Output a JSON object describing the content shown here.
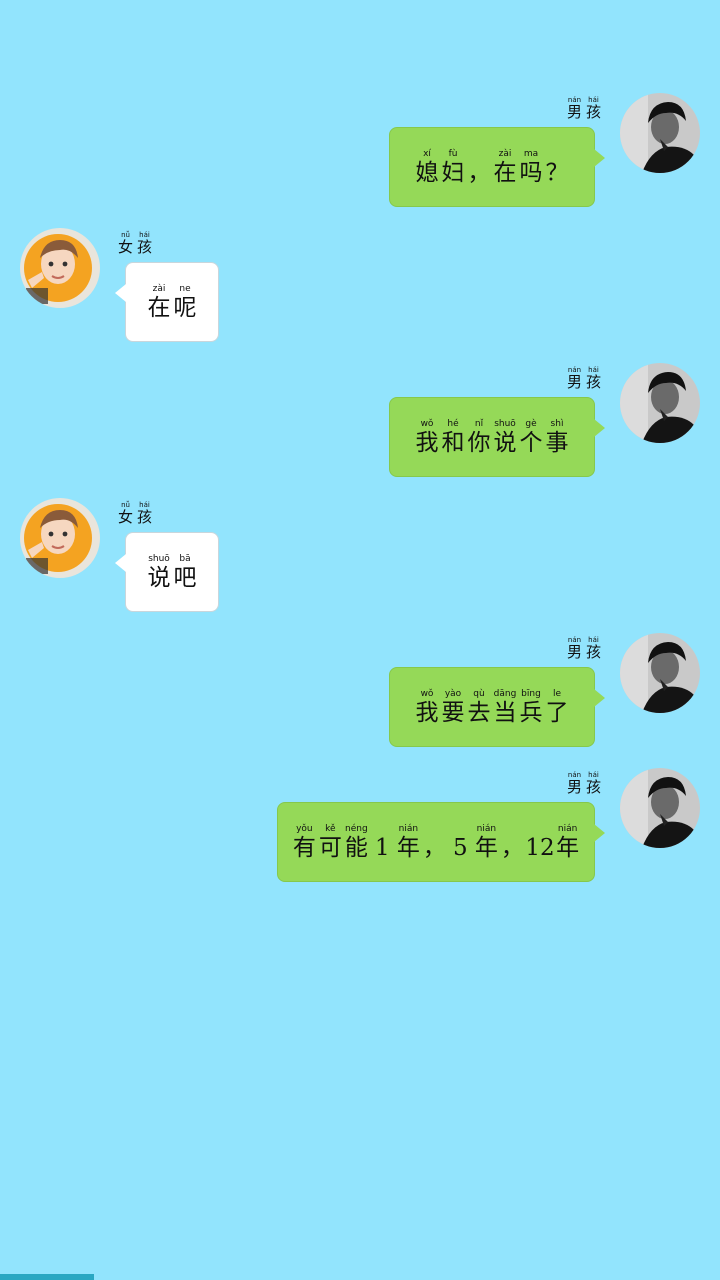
{
  "boy_name": [
    {
      "py": "nán",
      "hz": "男"
    },
    {
      "py": "hái",
      "hz": "孩"
    }
  ],
  "girl_name": [
    {
      "py": "nǚ",
      "hz": "女"
    },
    {
      "py": "hái",
      "hz": "孩"
    }
  ],
  "messages": [
    {
      "sender": "boy",
      "tokens": [
        {
          "py": "xí",
          "hz": "媳"
        },
        {
          "py": "fù",
          "hz": "妇"
        },
        {
          "py": "",
          "hz": "，"
        },
        {
          "py": "zài",
          "hz": "在"
        },
        {
          "py": "ma",
          "hz": "吗"
        },
        {
          "py": "",
          "hz": "？"
        }
      ]
    },
    {
      "sender": "girl",
      "tokens": [
        {
          "py": "zài",
          "hz": "在"
        },
        {
          "py": "ne",
          "hz": "呢"
        }
      ]
    },
    {
      "sender": "boy",
      "tokens": [
        {
          "py": "wǒ",
          "hz": "我"
        },
        {
          "py": "hé",
          "hz": "和"
        },
        {
          "py": "nǐ",
          "hz": "你"
        },
        {
          "py": "shuō",
          "hz": "说"
        },
        {
          "py": "gè",
          "hz": "个"
        },
        {
          "py": "shì",
          "hz": "事"
        }
      ]
    },
    {
      "sender": "girl",
      "tokens": [
        {
          "py": "shuō",
          "hz": "说"
        },
        {
          "py": "bā",
          "hz": "吧"
        }
      ]
    },
    {
      "sender": "boy",
      "tokens": [
        {
          "py": "wǒ",
          "hz": "我"
        },
        {
          "py": "yào",
          "hz": "要"
        },
        {
          "py": "qù",
          "hz": "去"
        },
        {
          "py": "dāng",
          "hz": "当"
        },
        {
          "py": "bīng",
          "hz": "兵"
        },
        {
          "py": "le",
          "hz": "了"
        }
      ]
    },
    {
      "sender": "boy",
      "tokens": [
        {
          "py": "yǒu",
          "hz": "有"
        },
        {
          "py": "kě",
          "hz": "可"
        },
        {
          "py": "néng",
          "hz": "能"
        },
        {
          "py": "",
          "hz": "1"
        },
        {
          "py": "nián",
          "hz": "年"
        },
        {
          "py": "",
          "hz": "，"
        },
        {
          "py": "",
          "hz": "5"
        },
        {
          "py": "nián",
          "hz": "年"
        },
        {
          "py": "",
          "hz": "，"
        },
        {
          "py": "",
          "hz": "12"
        },
        {
          "py": "nián",
          "hz": "年"
        }
      ]
    }
  ],
  "colors": {
    "background": "#92e4fd",
    "bubble_sent": "#95d958",
    "bubble_received": "#ffffff",
    "girl_avatar_accent": "#f4a321",
    "boy_avatar_tone": "#3a3a3a"
  }
}
